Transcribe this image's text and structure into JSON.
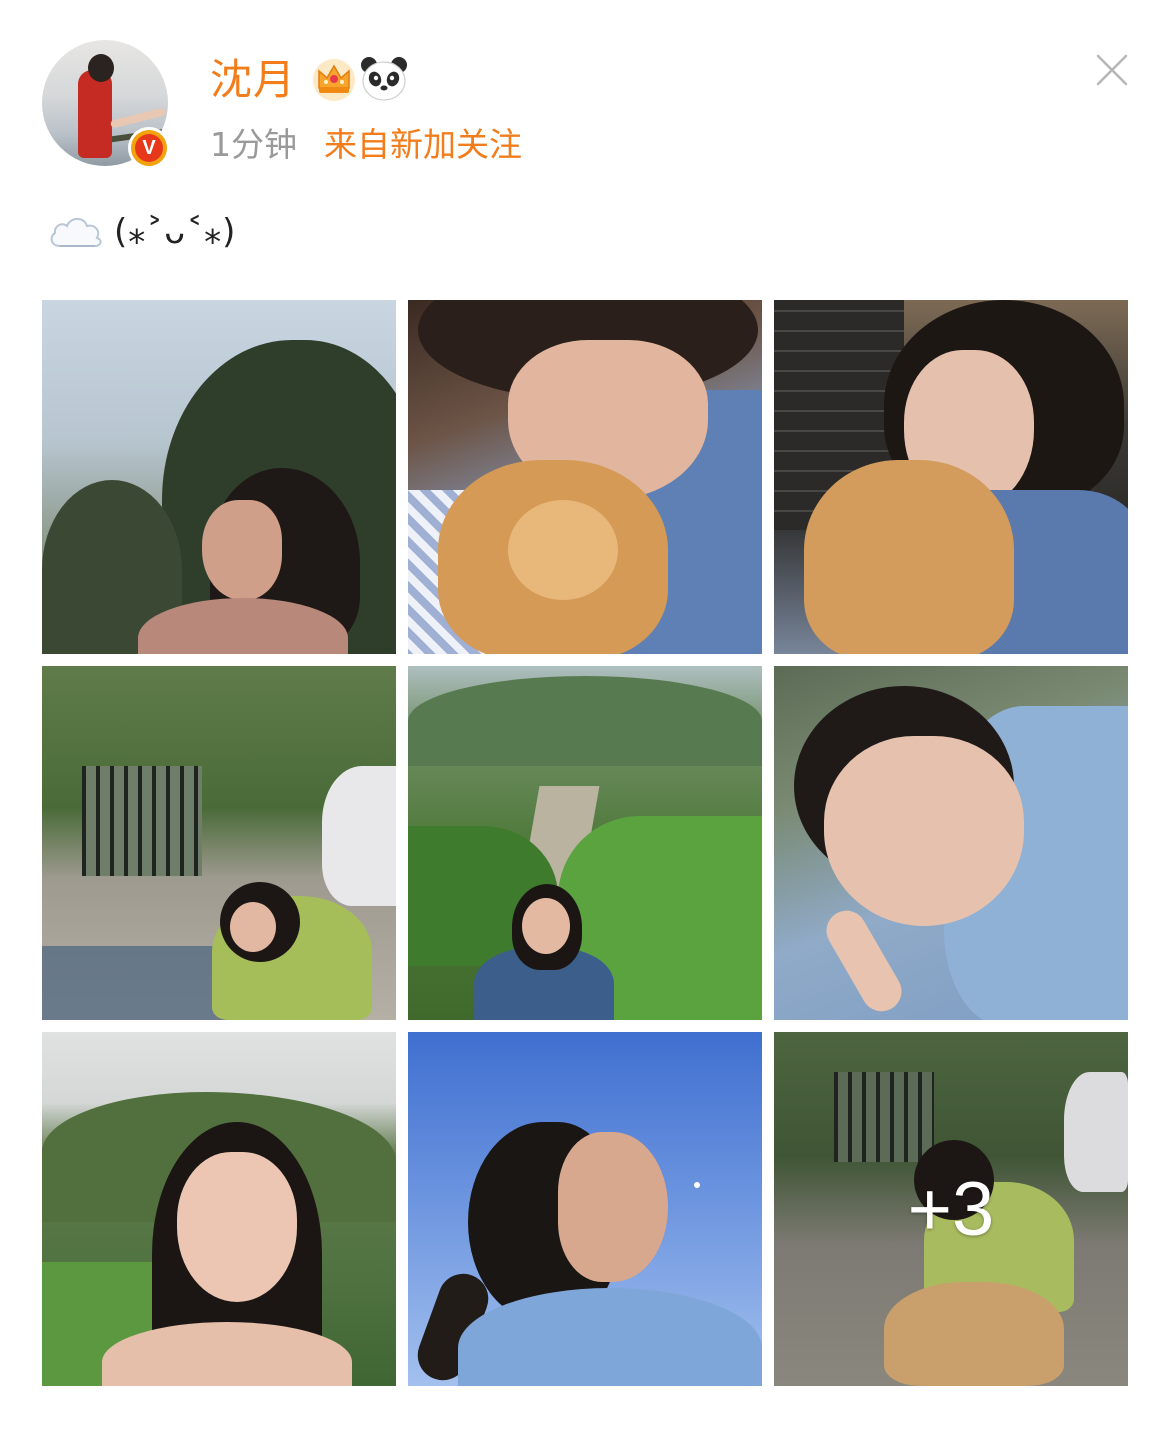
{
  "post": {
    "user": {
      "name": "沈月",
      "avatar": "avatar-photo",
      "verified_badge": "V",
      "badges": [
        "crown-icon",
        "panda-icon"
      ]
    },
    "time": "1分钟",
    "source": "来自新加关注",
    "text": "(⁎˃ᴗ˂⁎)",
    "leading_icon": "cloud-icon",
    "close_icon": "close-icon"
  },
  "photos": [
    {
      "name": "photo-1",
      "subject": "woman smiling by trees, sky background"
    },
    {
      "name": "photo-2",
      "subject": "woman hugging orange cat"
    },
    {
      "name": "photo-3",
      "subject": "woman with orange cat"
    },
    {
      "name": "photo-4",
      "subject": "woman crouching on road near car"
    },
    {
      "name": "photo-5",
      "subject": "woman standing among green plants"
    },
    {
      "name": "photo-6",
      "subject": "selfie lying down with earphones"
    },
    {
      "name": "photo-7",
      "subject": "woman smiling with hills"
    },
    {
      "name": "photo-8",
      "subject": "woman looking up at blue sky"
    },
    {
      "name": "photo-9",
      "subject": "woman with dog on road"
    }
  ],
  "more_count": "+3",
  "colors": {
    "accent": "#f27d1c",
    "meta_gray": "#9a9a9a",
    "badge_gold": "#f2a20d",
    "badge_red": "#e8381c"
  }
}
